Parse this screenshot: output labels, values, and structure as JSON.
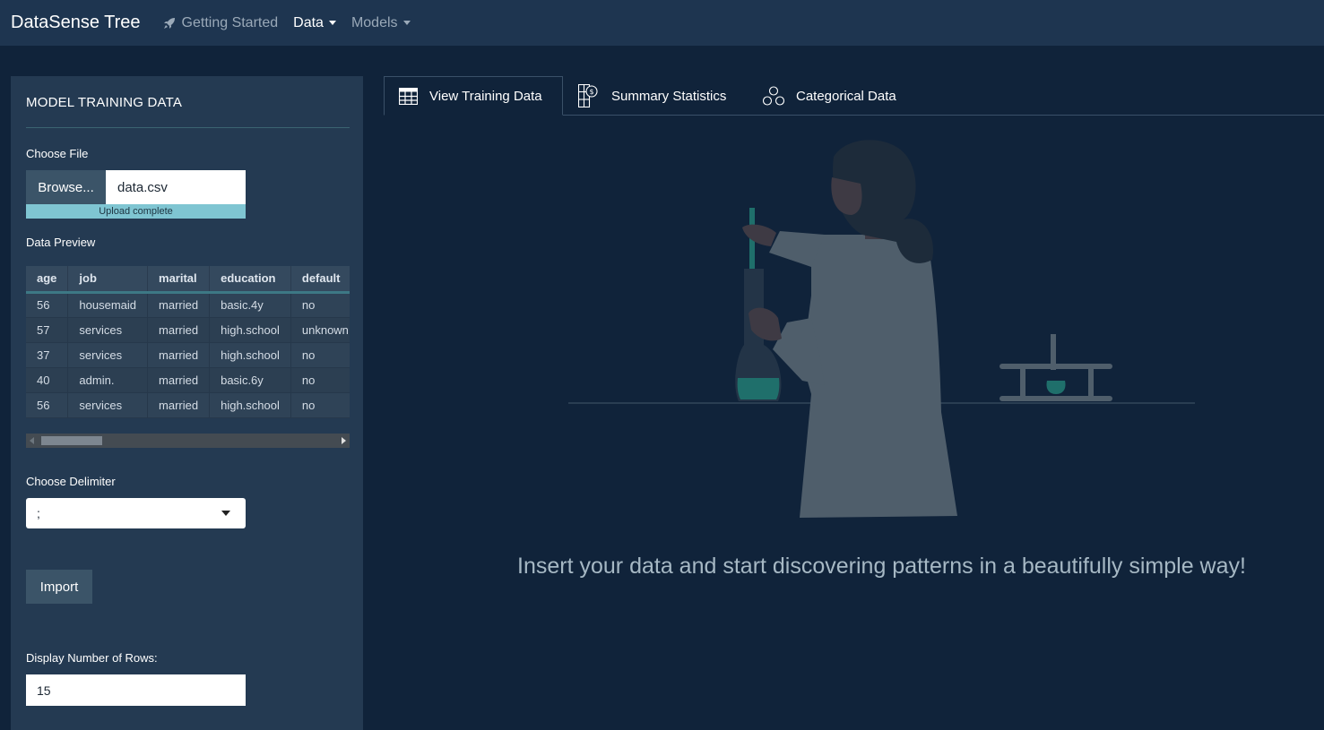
{
  "navbar": {
    "brand": "DataSense Tree",
    "items": [
      {
        "label": "Getting Started",
        "icon": "rocket-icon"
      },
      {
        "label": "Data",
        "dropdown": true,
        "active": true
      },
      {
        "label": "Models",
        "dropdown": true
      }
    ]
  },
  "sidebar": {
    "title": "MODEL TRAINING DATA",
    "choose_file_label": "Choose File",
    "browse_label": "Browse...",
    "file_name": "data.csv",
    "upload_status": "Upload complete",
    "upload_progress": 1.0,
    "preview_label": "Data Preview",
    "table": {
      "columns": [
        "age",
        "job",
        "marital",
        "education",
        "default"
      ],
      "rows": [
        [
          "56",
          "housemaid",
          "married",
          "basic.4y",
          "no"
        ],
        [
          "57",
          "services",
          "married",
          "high.school",
          "unknown"
        ],
        [
          "37",
          "services",
          "married",
          "high.school",
          "no"
        ],
        [
          "40",
          "admin.",
          "married",
          "basic.6y",
          "no"
        ],
        [
          "56",
          "services",
          "married",
          "high.school",
          "no"
        ]
      ]
    },
    "delimiter_label": "Choose Delimiter",
    "delimiter_value": ";",
    "import_label": "Import",
    "rows_label": "Display Number of Rows:",
    "rows_value": "15"
  },
  "tabs": [
    {
      "label": "View Training Data",
      "icon": "table-grid-icon",
      "active": true
    },
    {
      "label": "Summary Statistics",
      "icon": "statistics-icon"
    },
    {
      "label": "Categorical Data",
      "icon": "circles-icon"
    }
  ],
  "main": {
    "tagline": "Insert your data and start discovering patterns in a beautifully simple way!"
  },
  "colors": {
    "background": "#10233a",
    "navbar": "#1e3550",
    "sidebar": "#243a52",
    "progress": "#7fc5d2",
    "accent_teal": "#1f6f6b"
  }
}
